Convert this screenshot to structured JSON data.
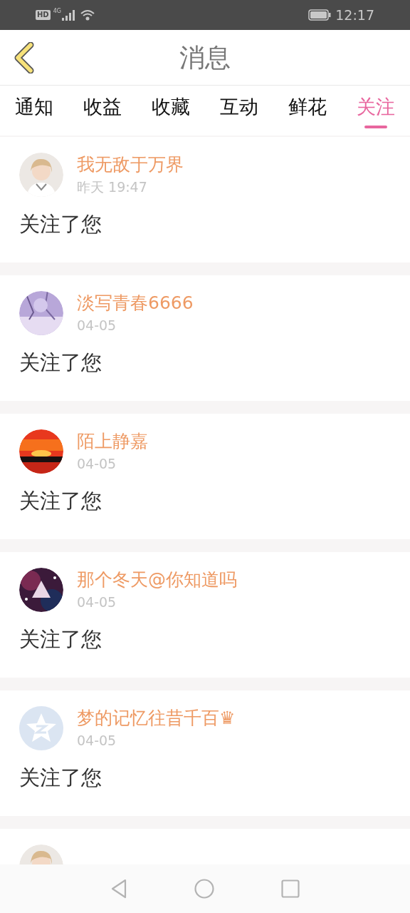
{
  "status_bar": {
    "hd": "HD",
    "network": "4G",
    "time": "12:17"
  },
  "header": {
    "title": "消息"
  },
  "tabs": [
    {
      "label": "通知",
      "selected": false
    },
    {
      "label": "收益",
      "selected": false
    },
    {
      "label": "收藏",
      "selected": false
    },
    {
      "label": "互动",
      "selected": false
    },
    {
      "label": "鲜花",
      "selected": false
    },
    {
      "label": "关注",
      "selected": true
    }
  ],
  "messages": [
    {
      "kind": "picture",
      "name": "我无敌于万界",
      "time": "昨天 19:47",
      "text": "关注了您"
    },
    {
      "kind": "picture",
      "name": "淡写青春6666",
      "time": "04-05",
      "text": "关注了您"
    },
    {
      "kind": "picture",
      "name": "陌上静嘉",
      "time": "04-05",
      "text": "关注了您"
    },
    {
      "kind": "picture",
      "name": "那个冬天@你知道吗",
      "time": "04-05",
      "text": "关注了您"
    },
    {
      "kind": "default",
      "name": "梦的记忆往昔千百♛",
      "time": "04-05",
      "text": "关注了您"
    },
    {
      "kind": "picture"
    }
  ]
}
